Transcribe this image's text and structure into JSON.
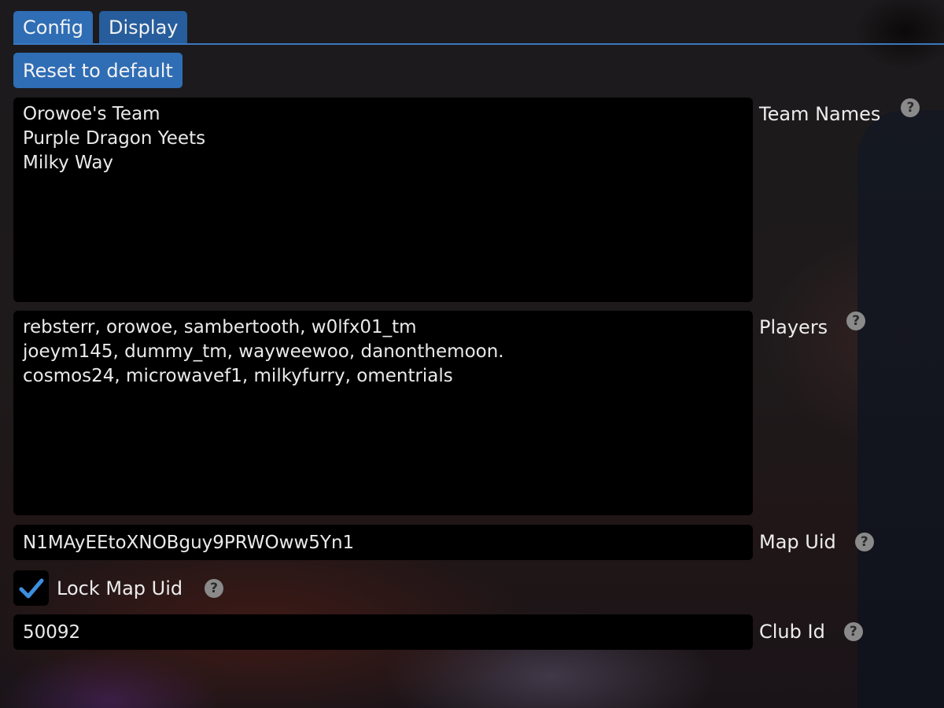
{
  "tabs": [
    {
      "label": "Config",
      "active": true
    },
    {
      "label": "Display",
      "active": false
    }
  ],
  "reset_button": {
    "label": "Reset to default"
  },
  "fields": {
    "team_names": {
      "label": "Team Names",
      "value": "Orowoe's Team\nPurple Dragon Yeets\nMilky Way",
      "help_icon": "question-circle-icon"
    },
    "players": {
      "label": "Players",
      "value": "rebsterr, orowoe, sambertooth, w0lfx01_tm\njoeym145, dummy_tm, wayweewoo, danonthemoon.\ncosmos24, microwavef1, milkyfurry, omentrials",
      "help_icon": "question-circle-icon"
    },
    "map_uid": {
      "label": "Map Uid",
      "value": "N1MAyEEtoXNOBguy9PRWOww5Yn1",
      "help_icon": "question-circle-icon"
    },
    "lock_map_uid": {
      "label": "Lock Map Uid",
      "checked": true,
      "check_icon": "checkmark-icon",
      "help_icon": "question-circle-icon"
    },
    "club_id": {
      "label": "Club Id",
      "value": "50092",
      "help_icon": "question-circle-icon"
    }
  },
  "icons": {
    "help_glyph": "?"
  },
  "colors": {
    "accent": "#2f6db5",
    "tab_inactive": "#275d9c",
    "tab_underline": "#3c78c0",
    "checkmark": "#3d8fe0",
    "field_bg": "#000000",
    "help_icon_bg": "#8a8a8a"
  }
}
